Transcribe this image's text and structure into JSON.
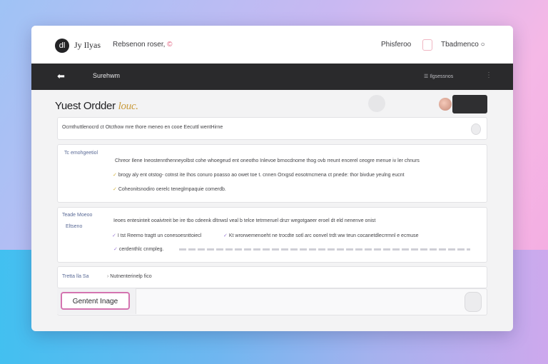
{
  "topbar": {
    "logo_text": "dl",
    "brand": "Jy Ilyas",
    "brand_sub": "Rebsenon roser,",
    "brand_mark": "©",
    "link_one": "Phisferoo",
    "link_two": "Tbadmenco",
    "link_two_icon": "○"
  },
  "navbar": {
    "back_icon": "⬅",
    "title": "Surehwm",
    "right_text": "☰ Ilgsessnos",
    "more_icon": "⋮"
  },
  "page": {
    "title": "Yuest Ordder",
    "title_accent": "louc."
  },
  "cards": {
    "row1": "Ocmthuttlenocrd ct Otcthow mre thore meneo en cooe Eecuttl wentHirne",
    "row2": {
      "label": "Tc emohgeetiol",
      "line1": "Chreor Ilene Ineostennthenneyolbst cohe whoegeud ent oneotho Inlevoe brnocdnome thog ovb rreunt encerel ceogre menue iv ler chnurs",
      "line2": "brogy aly ent otstog- cotnst ite Ihos conuro poasso ao owet toe t. cnnen Orxgsd eosotmcmena ct pnede: thor bivdue yeulng eucnt",
      "line3": "Coheonitsnodiro oerelc teneglmpaquie comerdb."
    },
    "row3": {
      "label": "Teade Moeoo",
      "label2": "Eltseno",
      "line1": "Ieoes entesinteit ooaivtreit be ire tbo cdeenk dltnwsl veal b telce tetrmeruel dnzr wegotgaeer eroel dt eld nenenve onist",
      "line2a": "I tst Reemo tragtt un conesoesnttoiecl",
      "line2b": "Kt wrorwemenoeht ne trocdte sotl arc oonvel trdt ww teun cocanetdlecrrmnl e ecmuse",
      "line3": "cerdenthlc cnmpleg."
    },
    "row4": {
      "label": "Tretta lla Sa",
      "text": "Nutnenterinelp fico"
    }
  },
  "action": {
    "button_label": "Gentent Inage"
  }
}
